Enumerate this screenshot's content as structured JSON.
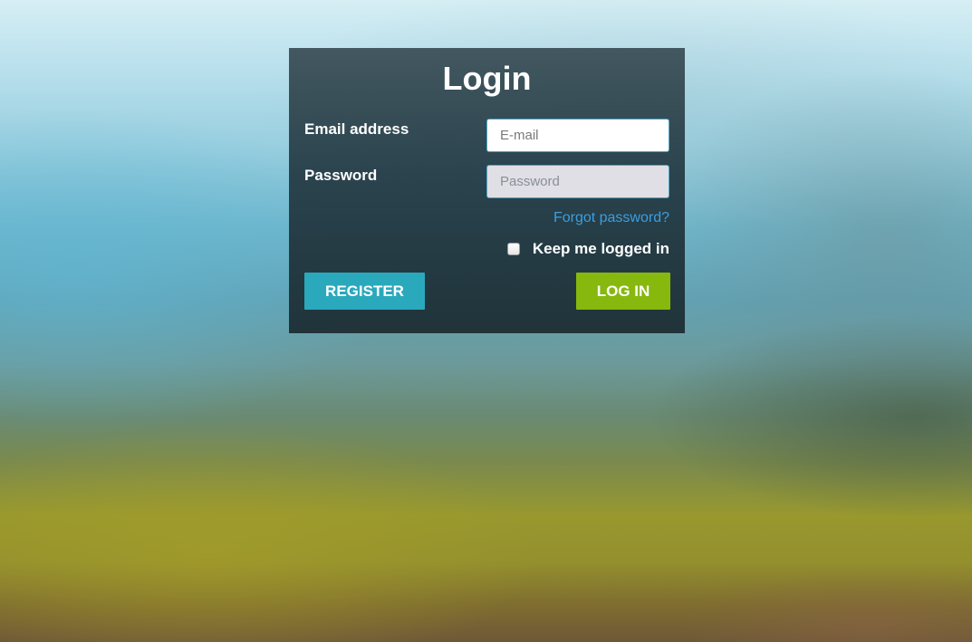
{
  "login": {
    "title": "Login",
    "email_label": "Email address",
    "email_placeholder": "E-mail",
    "email_value": "",
    "password_label": "Password",
    "password_placeholder": "Password",
    "password_value": "",
    "forgot_link": "Forgot password?",
    "keep_label": "Keep me logged in",
    "keep_checked": false,
    "register_label": "REGISTER",
    "login_label": "LOG IN"
  },
  "colors": {
    "register_button": "#2aa9bd",
    "login_button": "#86b80e",
    "link": "#3b9ee0",
    "input_border": "#4aa7c7"
  }
}
